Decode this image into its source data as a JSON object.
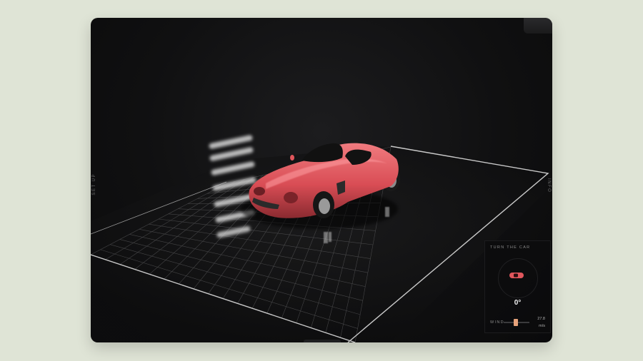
{
  "sidebar": {
    "left_label": "SET UP",
    "right_label": "INFO"
  },
  "control_panel": {
    "title": "TURN THE CAR",
    "angle": "0°",
    "wind": {
      "label": "WIND",
      "value": "27.8",
      "unit": "m/s",
      "fraction": 0.46
    }
  },
  "colors": {
    "page_background": "#dfe4d6",
    "car_body": "#e0565c",
    "accent_slider": "#e6a27a",
    "grid": "#9a9a9a"
  },
  "icons": {
    "car_top_icon": "car-top-view-icon"
  }
}
